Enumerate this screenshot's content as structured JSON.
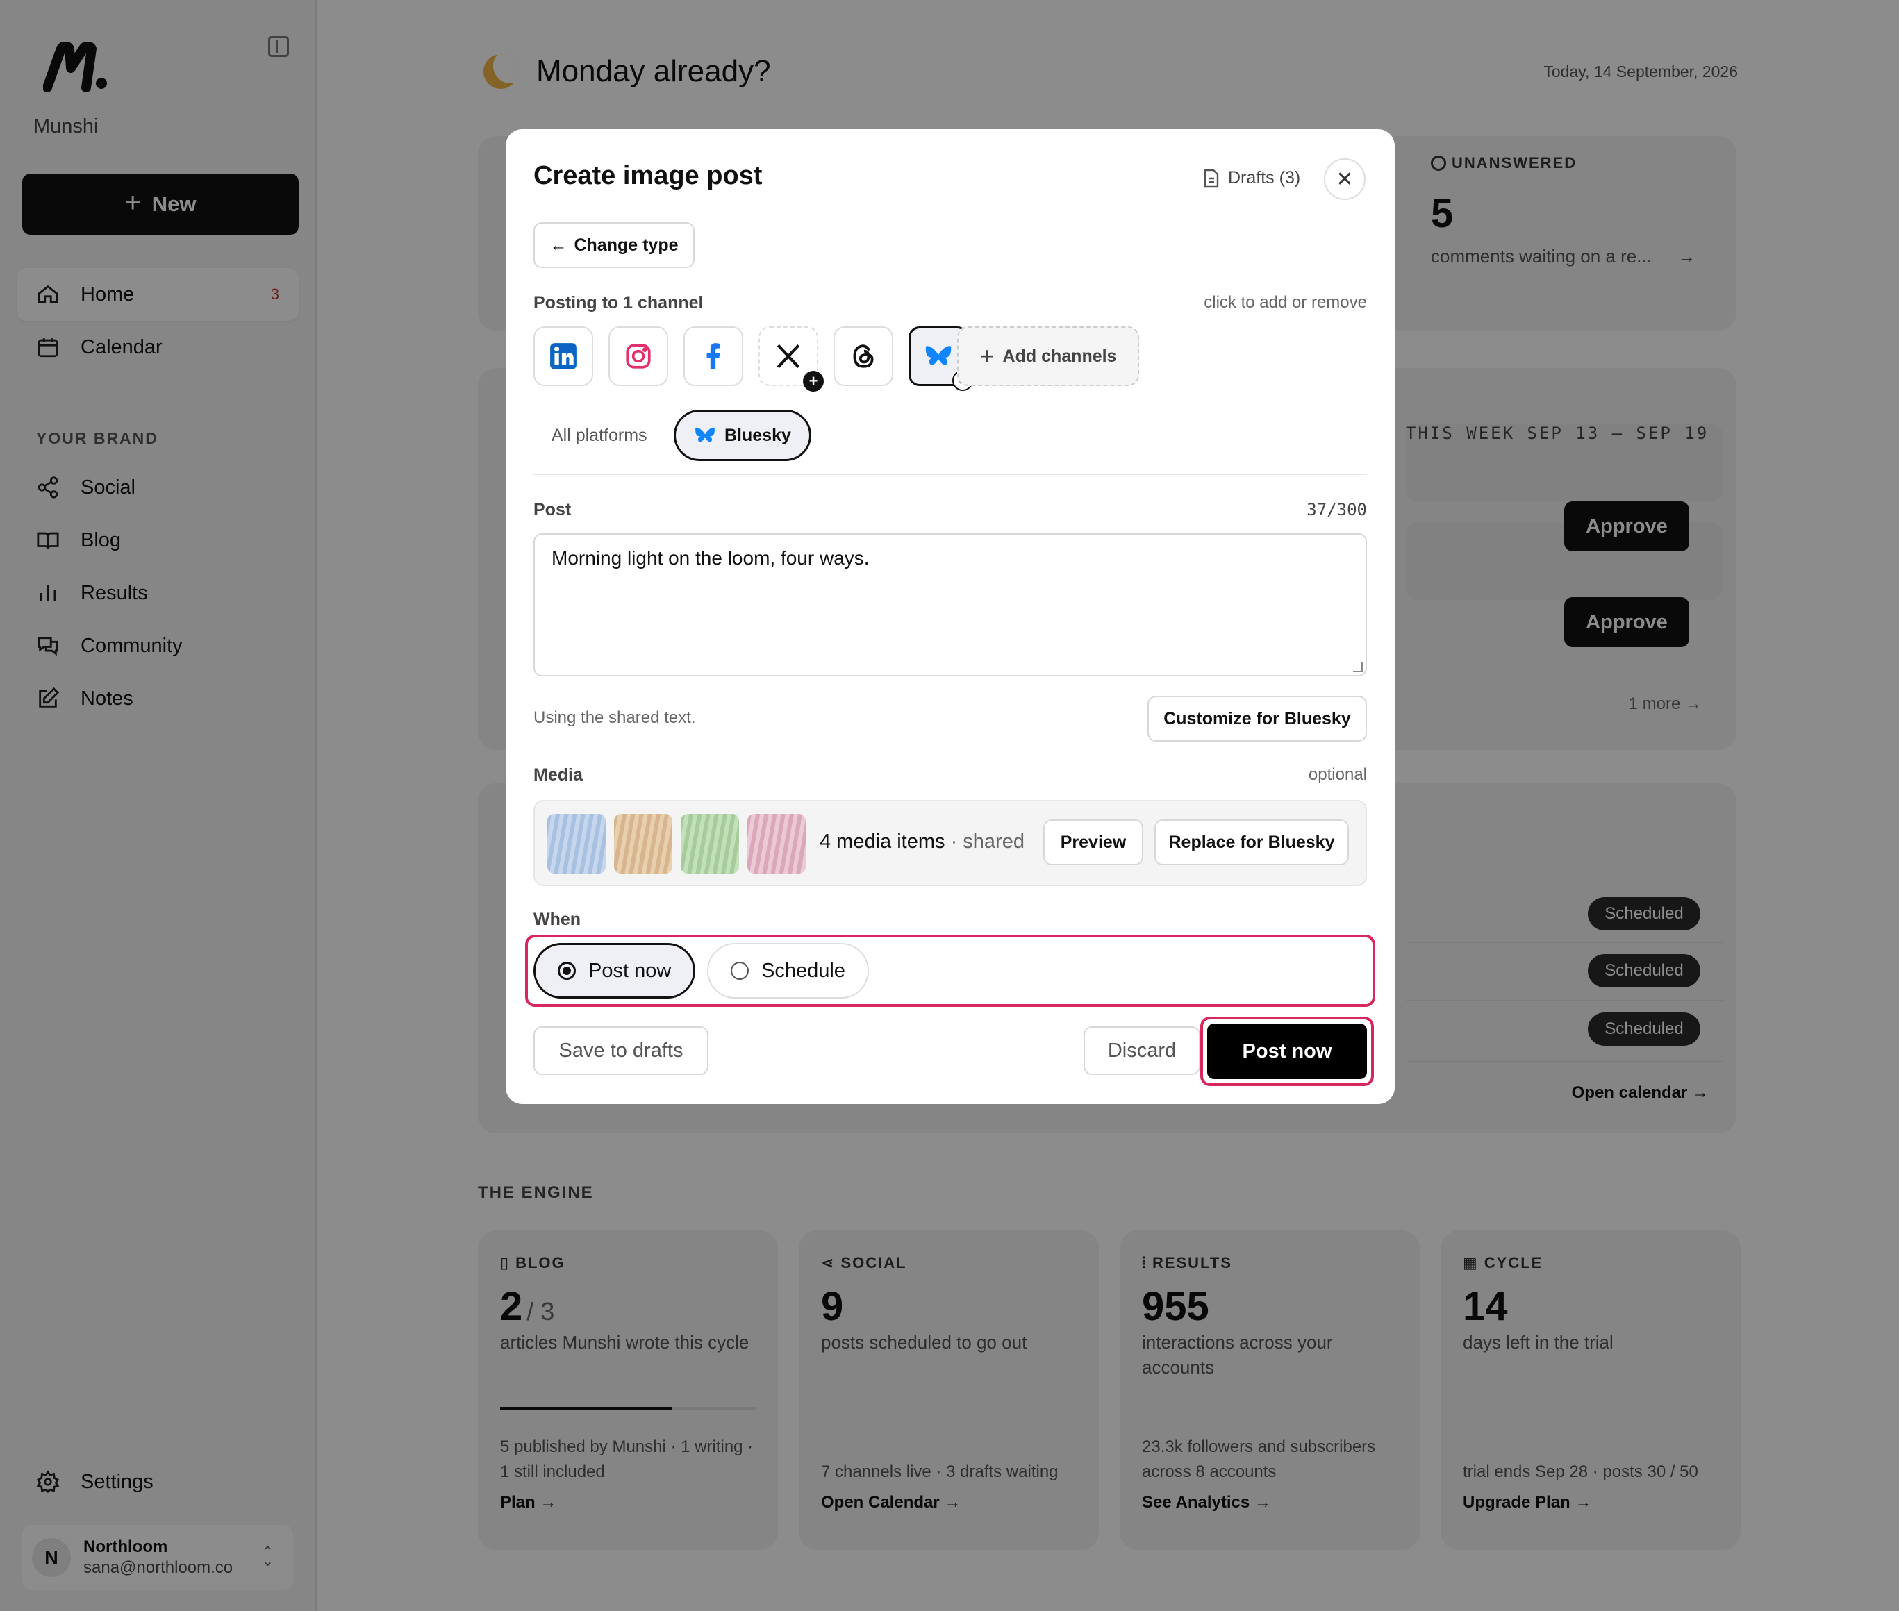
{
  "sidebar": {
    "brand": "Munshi",
    "new_label": "New",
    "nav": [
      {
        "label": "Home",
        "count": "3"
      },
      {
        "label": "Calendar"
      }
    ],
    "section_label": "YOUR BRAND",
    "brand_nav": [
      {
        "label": "Social"
      },
      {
        "label": "Blog"
      },
      {
        "label": "Results"
      },
      {
        "label": "Community"
      },
      {
        "label": "Notes"
      }
    ],
    "settings_label": "Settings",
    "account": {
      "initial": "N",
      "name": "Northloom",
      "email": "sana@northloom.co"
    }
  },
  "main": {
    "greeting": "Monday already?",
    "date": "Today, 14 September, 2026",
    "unanswered": {
      "label": "UNANSWERED",
      "value": "5",
      "sub": "comments waiting on a re..."
    },
    "week": "THIS WEEK   SEP 13 – SEP 19",
    "approve_label": "Approve",
    "more_label": "1 more",
    "scheduled_label": "Scheduled",
    "open_calendar": "Open calendar →",
    "engine_title": "THE ENGINE",
    "engine": [
      {
        "label": "BLOG",
        "value": "2",
        "value_suffix": "/ 3",
        "sub": "articles Munshi wrote this cycle",
        "progress": 0.67,
        "foot": "5 published by Munshi · 1 writing · 1 still included",
        "link": "Plan →"
      },
      {
        "label": "SOCIAL",
        "value": "9",
        "sub": "posts scheduled to go out",
        "foot": "7 channels live · 3 drafts waiting",
        "link": "Open Calendar →"
      },
      {
        "label": "RESULTS",
        "value": "955",
        "sub": "interactions across your accounts",
        "foot": "23.3k followers and subscribers across 8 accounts",
        "link": "See Analytics →"
      },
      {
        "label": "CYCLE",
        "value": "14",
        "sub": "days left in the trial",
        "foot": "trial ends Sep 28 · posts 30 / 50",
        "link": "Upgrade Plan →"
      }
    ]
  },
  "modal": {
    "title": "Create image post",
    "drafts": "Drafts (3)",
    "change_type": "Change type",
    "posting_to": "Posting to 1 channel",
    "click_hint": "click to add or remove",
    "add_channels": "Add channels",
    "tabs": {
      "all": "All platforms",
      "selected": "Bluesky"
    },
    "post_label": "Post",
    "char_count": "37/300",
    "post_text": "Morning light on the loom, four ways.",
    "shared_text": "Using the shared text.",
    "customize": "Customize for Bluesky",
    "media_label": "Media",
    "optional": "optional",
    "media_count": "4 media items",
    "media_shared": "· shared",
    "preview": "Preview",
    "replace": "Replace for Bluesky",
    "when_label": "When",
    "post_now_option": "Post now",
    "schedule_option": "Schedule",
    "save_drafts": "Save to drafts",
    "discard": "Discard",
    "post_now_button": "Post now"
  },
  "colors": {
    "accent_highlight": "#d6285c",
    "bluesky": "#1185fe",
    "linkedin": "#0a66c2",
    "instagram": "#e1306c",
    "facebook": "#1877f2"
  }
}
